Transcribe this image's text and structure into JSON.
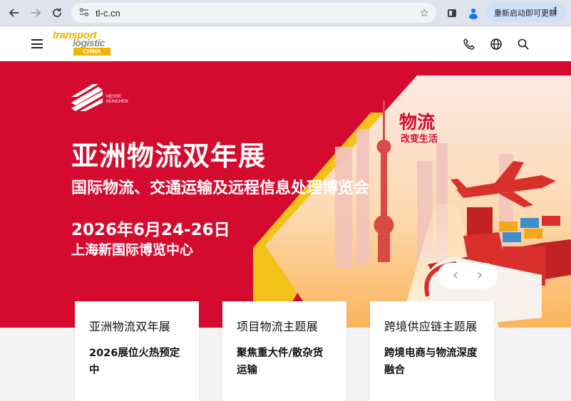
{
  "browser": {
    "url": "tl-c.cn",
    "update_button": "重新启动即可更新",
    "icons": [
      "back-icon",
      "forward-icon",
      "reload-icon",
      "site-info-icon",
      "bookmark-star-icon",
      "side-panel-icon",
      "profile-icon",
      "menu-dots-icon"
    ]
  },
  "header": {
    "logo": {
      "line1": "transport",
      "line2": "logistic",
      "line3": "CHINA"
    },
    "icons": [
      "hamburger-menu-icon",
      "phone-icon",
      "globe-icon",
      "search-icon"
    ]
  },
  "hero": {
    "brand_logo_text_1": "MESSE",
    "brand_logo_text_2": "MÜNCHEN",
    "title": "亚洲物流双年展",
    "subtitle": "国际物流、交通运输及远程信息处理博览会",
    "date": "2026年6月24-26日",
    "venue": "上海新国际博览中心",
    "slogan_main": "物流",
    "slogan_sub": "改变生活",
    "carousel_prev": "‹",
    "carousel_next": "›"
  },
  "cards": [
    {
      "title": "亚洲物流双年展",
      "description": "2026展位火热预定中"
    },
    {
      "title": "项目物流主题展",
      "description": "聚焦重大件/散杂货运输"
    },
    {
      "title": "跨境供应链主题展",
      "description": "跨境电商与物流深度融合"
    }
  ],
  "colors": {
    "brand_red": "#d40a2f",
    "logo_yellow": "#f0b400",
    "browser_chrome": "#dfe3eb",
    "update_chip": "#cfe0fb"
  }
}
